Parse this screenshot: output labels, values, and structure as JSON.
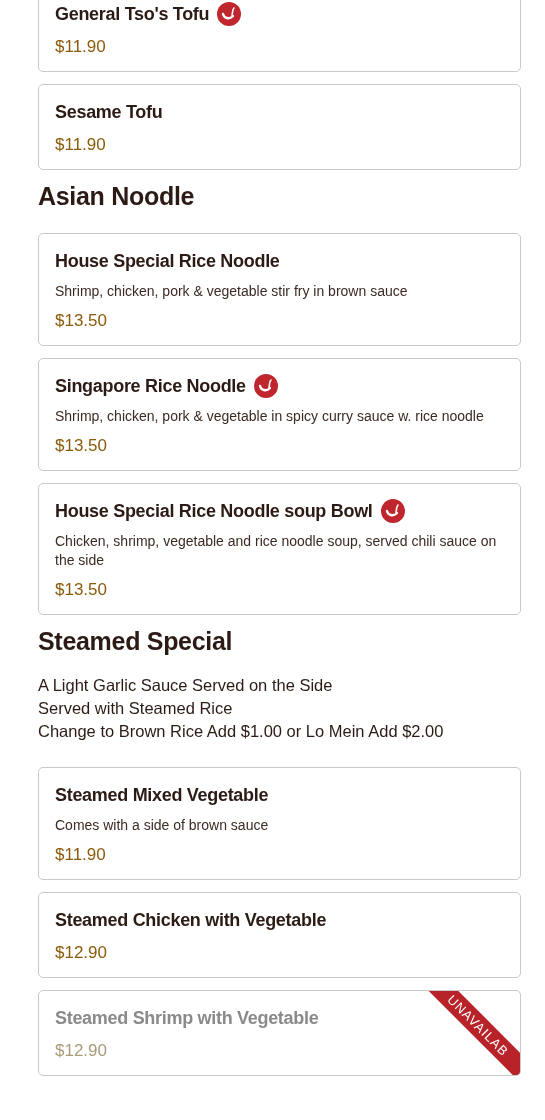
{
  "sections": [
    {
      "items": [
        {
          "name": "General Tso's Tofu",
          "spicy": true,
          "price": "$11.90",
          "available": true
        },
        {
          "name": "Sesame Tofu",
          "spicy": false,
          "price": "$11.90",
          "available": true
        }
      ]
    },
    {
      "title": "Asian Noodle",
      "items": [
        {
          "name": "House Special Rice Noodle",
          "spicy": false,
          "description": "Shrimp, chicken, pork & vegetable stir fry in brown sauce",
          "price": "$13.50",
          "available": true
        },
        {
          "name": "Singapore Rice Noodle",
          "spicy": true,
          "description": "Shrimp, chicken, pork & vegetable in spicy curry sauce w. rice noodle",
          "price": "$13.50",
          "available": true
        },
        {
          "name": "House Special Rice Noodle soup Bowl",
          "spicy": true,
          "description": "Chicken, shrimp, vegetable and rice noodle soup, served chili sauce on the side",
          "price": "$13.50",
          "available": true
        }
      ]
    },
    {
      "title": "Steamed Special",
      "notes": [
        "A Light Garlic Sauce Served on the Side",
        "Served with Steamed Rice",
        "Change to Brown Rice Add $1.00 or Lo Mein Add $2.00"
      ],
      "items": [
        {
          "name": "Steamed Mixed Vegetable",
          "spicy": false,
          "description": "Comes with a side of brown sauce",
          "price": "$11.90",
          "available": true
        },
        {
          "name": "Steamed Chicken with Vegetable",
          "spicy": false,
          "price": "$12.90",
          "available": true
        },
        {
          "name": "Steamed Shrimp with Vegetable",
          "spicy": false,
          "price": "$12.90",
          "available": false,
          "ribbon": "UNAVAILAB"
        }
      ]
    }
  ]
}
